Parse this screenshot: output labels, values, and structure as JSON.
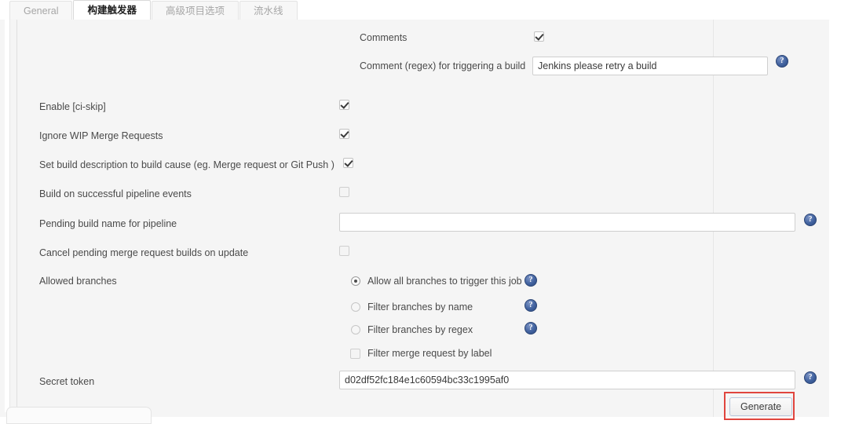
{
  "tabs": [
    {
      "label": "General",
      "active": false
    },
    {
      "label": "构建触发器",
      "active": true
    },
    {
      "label": "高级项目选项",
      "active": false
    },
    {
      "label": "流水线",
      "active": false
    }
  ],
  "form": {
    "comments": {
      "label": "Comments",
      "checked": true
    },
    "comment_regex": {
      "label": "Comment (regex) for triggering a build",
      "value": "Jenkins please retry a build",
      "help": "?"
    },
    "enable_ci_skip": {
      "label": "Enable [ci-skip]",
      "checked": true
    },
    "ignore_wip": {
      "label": "Ignore WIP Merge Requests",
      "checked": true
    },
    "set_build_description": {
      "label": "Set build description to build cause (eg. Merge request or Git Push )",
      "checked": true
    },
    "build_on_pipeline_events": {
      "label": "Build on successful pipeline events",
      "checked": false
    },
    "pending_build_name": {
      "label": "Pending build name for pipeline",
      "value": "",
      "placeholder": "",
      "help": "?"
    },
    "cancel_pending_builds": {
      "label": "Cancel pending merge request builds on update",
      "checked": false
    },
    "allowed_branches": {
      "label": "Allowed branches",
      "options": [
        {
          "label": "Allow all branches to trigger this job",
          "selected": true,
          "help": "?"
        },
        {
          "label": "Filter branches by name",
          "selected": false,
          "help": "?"
        },
        {
          "label": "Filter branches by regex",
          "selected": false,
          "help": "?"
        }
      ],
      "filter_by_label": {
        "label": "Filter merge request by label",
        "checked": false
      }
    },
    "secret_token": {
      "label": "Secret token",
      "value": "d02df52fc184e1c60594bc33c1995af0",
      "help": "?"
    },
    "generate_button": {
      "label": "Generate"
    }
  },
  "colors": {
    "highlight": "#e0453e",
    "help_icon": "#41629f",
    "panel_bg": "#f5f5f5",
    "active_tab_text": "#1f1f1f",
    "inactive_tab_text": "#a6a6a6"
  }
}
